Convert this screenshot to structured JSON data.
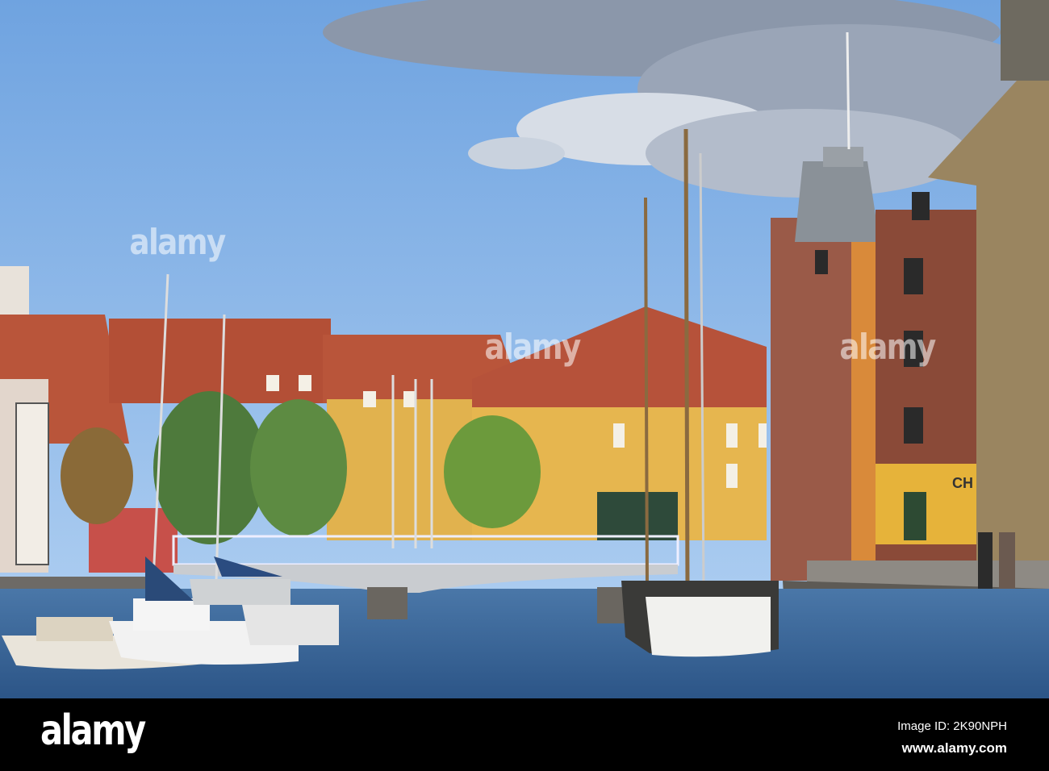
{
  "watermark": {
    "text": "alamy"
  },
  "shop_sign": {
    "text": "CH"
  },
  "footer": {
    "logo": "alamy",
    "image_id": "Image ID: 2K90NPH",
    "url": "www.alamy.com"
  },
  "colors": {
    "sky_top": "#6fa3e0",
    "sky_bottom": "#b5d3f3",
    "roof": "#b9553a",
    "yellow_facade": "#e1b24e",
    "brick": "#8a4a38",
    "water": "#335f93"
  }
}
